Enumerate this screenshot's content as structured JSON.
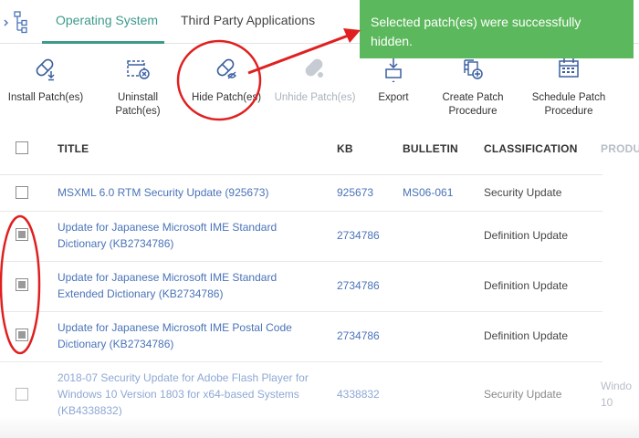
{
  "tabs": {
    "operating_system": "Operating System",
    "third_party": "Third Party Applications"
  },
  "toast": {
    "message": "Selected patch(es) were successfully hidden."
  },
  "toolbar": {
    "install": "Install Patch(es)",
    "uninstall_line1": "Uninstall",
    "uninstall_line2": "Patch(es)",
    "hide": "Hide Patch(es)",
    "unhide": "Unhide Patch(es)",
    "export": "Export",
    "create_line1": "Create Patch",
    "create_line2": "Procedure",
    "schedule_line1": "Schedule Patch",
    "schedule_line2": "Procedure"
  },
  "table": {
    "columns": {
      "title": "TITLE",
      "kb": "KB",
      "bulletin": "BULLETIN",
      "classification": "CLASSIFICATION",
      "product": "PRODU"
    },
    "rows": [
      {
        "title_l1": "MSXML 6.0 RTM Security Update (925673)",
        "kb": "925673",
        "bulletin": "MS06-061",
        "classification": "Security Update",
        "checked": false
      },
      {
        "title_l1": "Update for Japanese Microsoft IME Standard",
        "title_l2": "Dictionary (KB2734786)",
        "kb": "2734786",
        "bulletin": "",
        "classification": "Definition Update",
        "checked": true
      },
      {
        "title_l1": "Update for Japanese Microsoft IME Standard",
        "title_l2": "Extended Dictionary (KB2734786)",
        "kb": "2734786",
        "bulletin": "",
        "classification": "Definition Update",
        "checked": true
      },
      {
        "title_l1": "Update for Japanese Microsoft IME Postal Code",
        "title_l2": "Dictionary (KB2734786)",
        "kb": "2734786",
        "bulletin": "",
        "classification": "Definition Update",
        "checked": true
      },
      {
        "title_l1": "2018-07 Security Update for Adobe Flash Player for",
        "title_l2": "Windows 10 Version 1803 for x64-based Systems",
        "title_l3": "(KB4338832)",
        "kb": "4338832",
        "bulletin": "",
        "classification": "Security Update",
        "product_l1": "Windo",
        "product_l2": "10",
        "checked": false
      }
    ]
  },
  "colors": {
    "accent": "#3d9a8b",
    "toast_bg": "#5cb85c",
    "link": "#4a73b8",
    "annotation_red": "#e02020"
  }
}
